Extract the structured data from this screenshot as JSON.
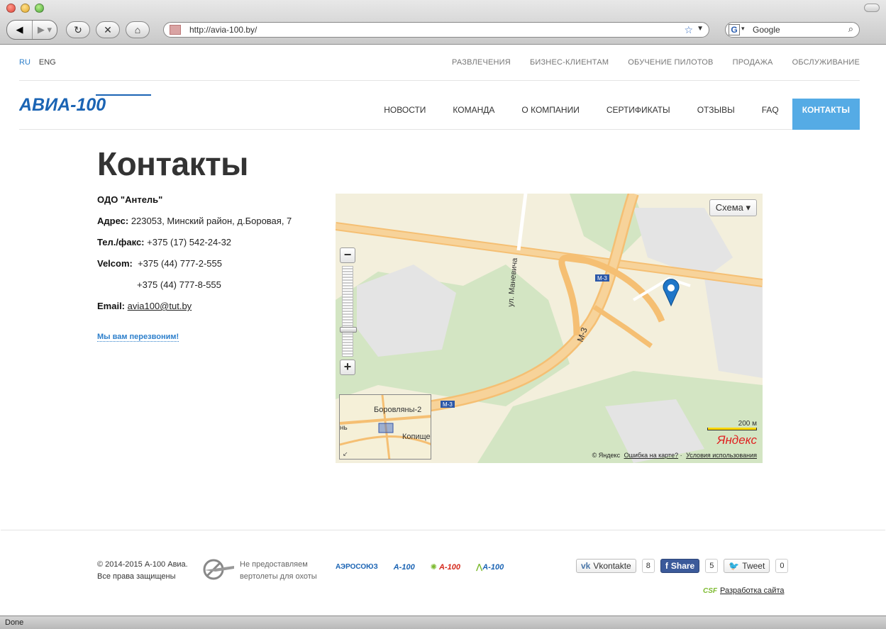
{
  "browser": {
    "url": "http://avia-100.by/",
    "search_placeholder": "Google",
    "status": "Done"
  },
  "lang": {
    "ru": "RU",
    "eng": "ENG"
  },
  "top_menu": [
    "РАЗВЛЕЧЕНИЯ",
    "БИЗНЕС-КЛИЕНТАМ",
    "ОБУЧЕНИЕ ПИЛОТОВ",
    "ПРОДАЖА",
    "ОБСЛУЖИВАНИЕ"
  ],
  "logo": "АВИА-100",
  "main_menu": [
    "НОВОСТИ",
    "КОМАНДА",
    "О КОМПАНИИ",
    "СЕРТИФИКАТЫ",
    "ОТЗЫВЫ",
    "FAQ",
    "КОНТАКТЫ"
  ],
  "page_title": "Контакты",
  "contacts": {
    "company": "ОДО \"Антель\"",
    "address_label": "Адрес:",
    "address": "223053, Минский район, д.Боровая, 7",
    "tel_label": "Тел./факс:",
    "tel": "+375 (17) 542-24-32",
    "velcom_label": "Velcom:",
    "velcom1": "+375 (44) 777-2-555",
    "velcom2": "+375 (44) 777-8-555",
    "email_label": "Email:",
    "email": "avia100@tut.by",
    "callback": "Мы вам перезвоним!"
  },
  "map": {
    "type_button": "Схема ▾",
    "road_m3": "М-3",
    "street": "ул. Маневича",
    "mini_label1": "Боровляны-2",
    "mini_label2": "Копище",
    "mini_label3": "нь",
    "scale": "200 м",
    "yandex": "Яндекс",
    "copyright": "© Яндекс",
    "error_link": "Ошибка на карте?",
    "terms_link": "Условия использования"
  },
  "footer": {
    "copyright_line1": "© 2014-2015 А-100 Авиа.",
    "copyright_line2": "Все права защищены",
    "nohunt_line1": "Не предоставляем",
    "nohunt_line2": "вертолеты для охоты",
    "partners": [
      "АЭРОСОЮЗ",
      "А-100",
      "А-100",
      "А-100"
    ],
    "vk_label": "Vkontakte",
    "vk_count": "8",
    "fb_label": "Share",
    "fb_count": "5",
    "tw_label": "Tweet",
    "tw_count": "0",
    "dev_logo": "CSF",
    "dev_link": "Разработка сайта"
  }
}
